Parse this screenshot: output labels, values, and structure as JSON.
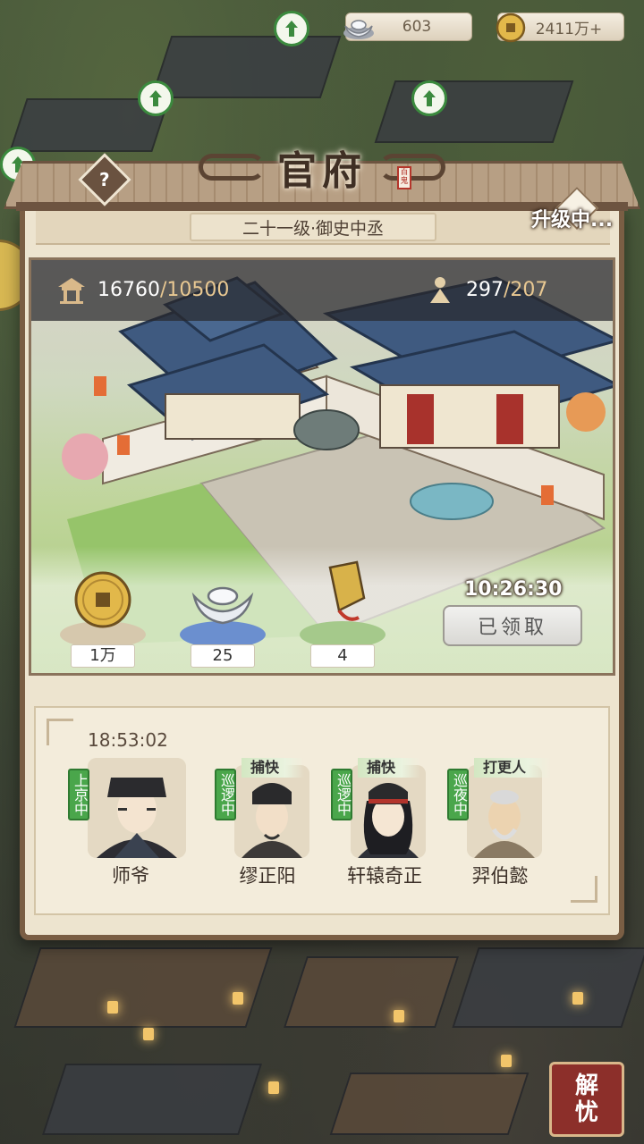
{
  "currencies": {
    "silver": {
      "value": "603",
      "icon": "silver-ingot-icon"
    },
    "coins": {
      "value": "2411万+",
      "icon": "copper-coin-icon"
    }
  },
  "panel": {
    "title": "官府",
    "seal_text": "百鬼",
    "rank": "二十一级·御史中丞",
    "status": "升级中...",
    "stats": {
      "building": {
        "current": "16760",
        "max": "/10500",
        "icon": "pavilion-icon"
      },
      "people": {
        "current": "297",
        "max": "/207",
        "icon": "person-icon"
      }
    },
    "rewards": [
      {
        "icon": "copper-coin-icon",
        "label": "1万"
      },
      {
        "icon": "silver-ingot-icon",
        "label": "25"
      },
      {
        "icon": "token-banner-icon",
        "label": "4"
      }
    ],
    "reward_timer": "10:26:30",
    "claim_button": "已领取"
  },
  "staff": {
    "timer": "18:53:02",
    "members": [
      {
        "name": "师爷",
        "status": "上京中",
        "role": ""
      },
      {
        "name": "缪正阳",
        "status": "巡逻中",
        "role": "捕快"
      },
      {
        "name": "轩辕奇正",
        "status": "巡逻中",
        "role": "捕快"
      },
      {
        "name": "羿伯懿",
        "status": "巡夜中",
        "role": "打更人"
      }
    ]
  },
  "corner_badge": {
    "line1": "解",
    "line2": "忧"
  },
  "colors": {
    "status_green": "#4aa64b",
    "panel_bg": "#ede4cf",
    "frame_brown": "#7a5e44"
  }
}
